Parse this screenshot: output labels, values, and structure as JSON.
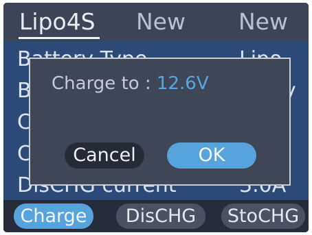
{
  "tabs": [
    {
      "label": "Lipo4S"
    },
    {
      "label": "New"
    },
    {
      "label": "New"
    }
  ],
  "list": [
    {
      "label": "Battery Type",
      "value": "Lipo"
    },
    {
      "label": "B",
      "value": "y"
    },
    {
      "label": "C",
      "value": ""
    },
    {
      "label": "C",
      "value": ""
    },
    {
      "label": "DisCHG current",
      "value": "3.0A"
    }
  ],
  "dialog": {
    "message": "Charge to : ",
    "value": "12.6V",
    "cancel_label": "Cancel",
    "ok_label": "OK"
  },
  "modes": [
    {
      "label": "Charge"
    },
    {
      "label": "DisCHG"
    },
    {
      "label": "StoCHG"
    }
  ],
  "colors": {
    "accent": "#57a4dd",
    "panel": "#3a4354",
    "list_bg": "#2c4a78"
  }
}
